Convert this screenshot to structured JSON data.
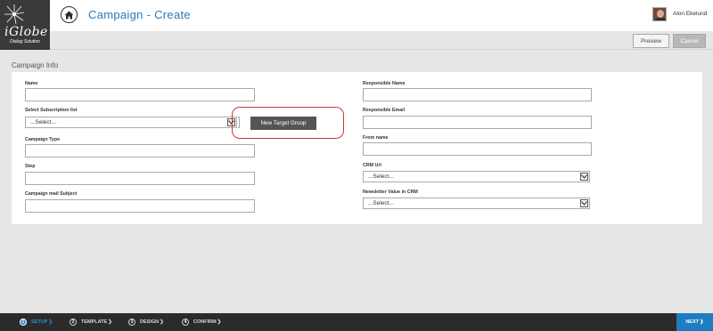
{
  "header": {
    "logo_text": "iGlobe",
    "logo_tagline": "Dialog Solution",
    "page_title": "Campaign - Create",
    "user_name": "Alon Ekelund"
  },
  "toolbar": {
    "preview_label": "Preview",
    "cancel_label": "Cancel"
  },
  "section": {
    "title": "Campaign Info"
  },
  "form": {
    "left": {
      "name_label": "Name",
      "name_value": "",
      "subscription_label": "Select Subscription list",
      "subscription_value": "...Select...",
      "campaign_type_label": "Campaign Type",
      "campaign_type_value": "",
      "step_label": "Step",
      "step_value": "",
      "mail_subject_label": "Campaign mail Subject",
      "mail_subject_value": ""
    },
    "new_target_group_label": "New Target Group",
    "right": {
      "responsible_name_label": "Responsible Name",
      "responsible_name_value": "",
      "responsible_email_label": "Responsible Email",
      "responsible_email_value": "",
      "from_name_label": "From name",
      "from_name_value": "",
      "crm_url_label": "CRM Url",
      "crm_url_value": "...Select...",
      "newsletter_label": "Newsletter Value in CRM",
      "newsletter_value": "...Select..."
    }
  },
  "wizard": {
    "steps": [
      {
        "number": "1",
        "label": "SETUP",
        "active": true
      },
      {
        "number": "2",
        "label": "TEMPLATE",
        "active": false
      },
      {
        "number": "3",
        "label": "DESIGN",
        "active": false
      },
      {
        "number": "4",
        "label": "CONFIRM",
        "active": false
      }
    ],
    "next_label": "NEXT"
  },
  "colors": {
    "accent": "#2a7ab8",
    "next_button": "#1e7cc1",
    "highlight_ring": "#c43a3a",
    "footer": "#2b2b2b"
  }
}
